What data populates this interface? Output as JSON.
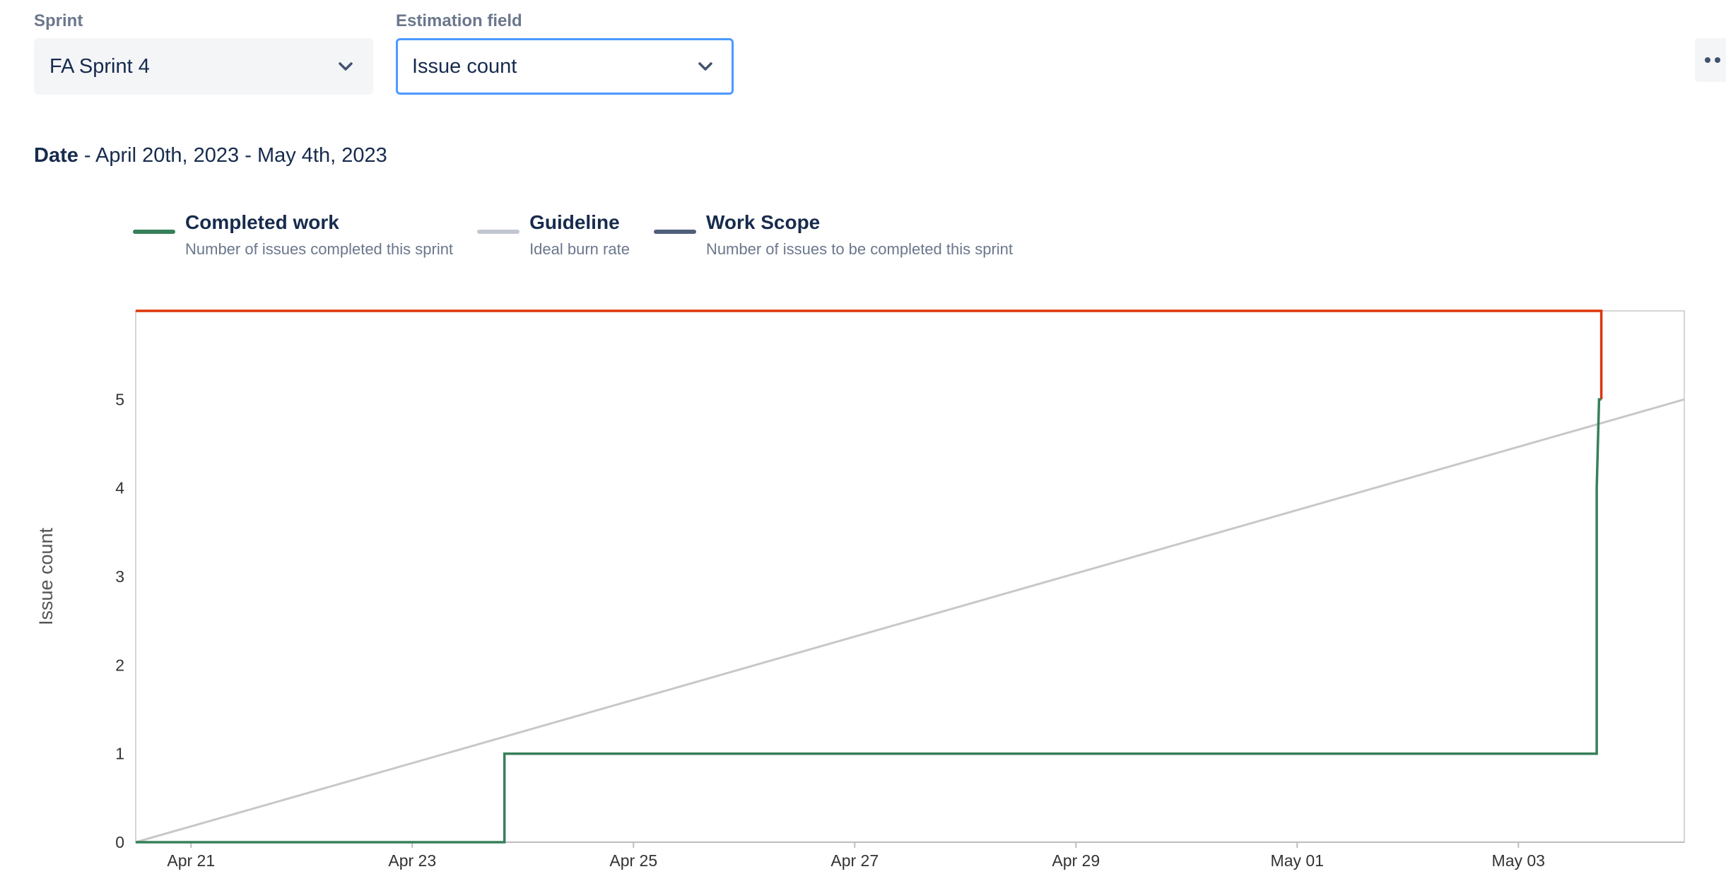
{
  "controls": {
    "sprint": {
      "label": "Sprint",
      "value": "FA Sprint 4"
    },
    "estimation": {
      "label": "Estimation field",
      "value": "Issue count"
    }
  },
  "date": {
    "label": "Date",
    "range": "- April 20th, 2023 - May 4th, 2023"
  },
  "legend": [
    {
      "title": "Completed work",
      "desc": "Number of issues completed this sprint",
      "color": "#36805A"
    },
    {
      "title": "Guideline",
      "desc": "Ideal burn rate",
      "color": "#C1C7D0"
    },
    {
      "title": "Work Scope",
      "desc": "Number of issues to be completed this sprint",
      "color": "#505F79"
    }
  ],
  "chart_data": {
    "type": "line",
    "ylabel": "Issue count",
    "ylim": [
      0,
      6
    ],
    "y_ticks": [
      0,
      1,
      2,
      3,
      4,
      5
    ],
    "x_ticks": [
      "Apr 21",
      "Apr 23",
      "Apr 25",
      "Apr 27",
      "Apr 29",
      "May 01",
      "May 03"
    ],
    "x_range": [
      "2023-04-20 12:00",
      "2023-05-04 12:00"
    ],
    "grid": false,
    "series": [
      {
        "name": "Completed work",
        "color": "#36805A",
        "step": true,
        "points": [
          [
            "2023-04-20 12:00",
            0
          ],
          [
            "2023-04-23 20:00",
            0
          ],
          [
            "2023-04-23 20:00",
            1
          ],
          [
            "2023-05-03 17:00",
            1
          ],
          [
            "2023-05-03 17:00",
            4
          ],
          [
            "2023-05-03 17:30",
            5
          ],
          [
            "2023-05-03 18:00",
            5
          ]
        ]
      },
      {
        "name": "Guideline",
        "color": "#C8C8C8",
        "points": [
          [
            "2023-04-20 12:00",
            0
          ],
          [
            "2023-05-04 12:00",
            5
          ]
        ]
      },
      {
        "name": "Work Scope",
        "color": "#DE350B",
        "step": true,
        "points": [
          [
            "2023-04-20 12:00",
            6
          ],
          [
            "2023-05-03 18:00",
            6
          ],
          [
            "2023-05-03 18:00",
            5
          ]
        ]
      }
    ]
  }
}
